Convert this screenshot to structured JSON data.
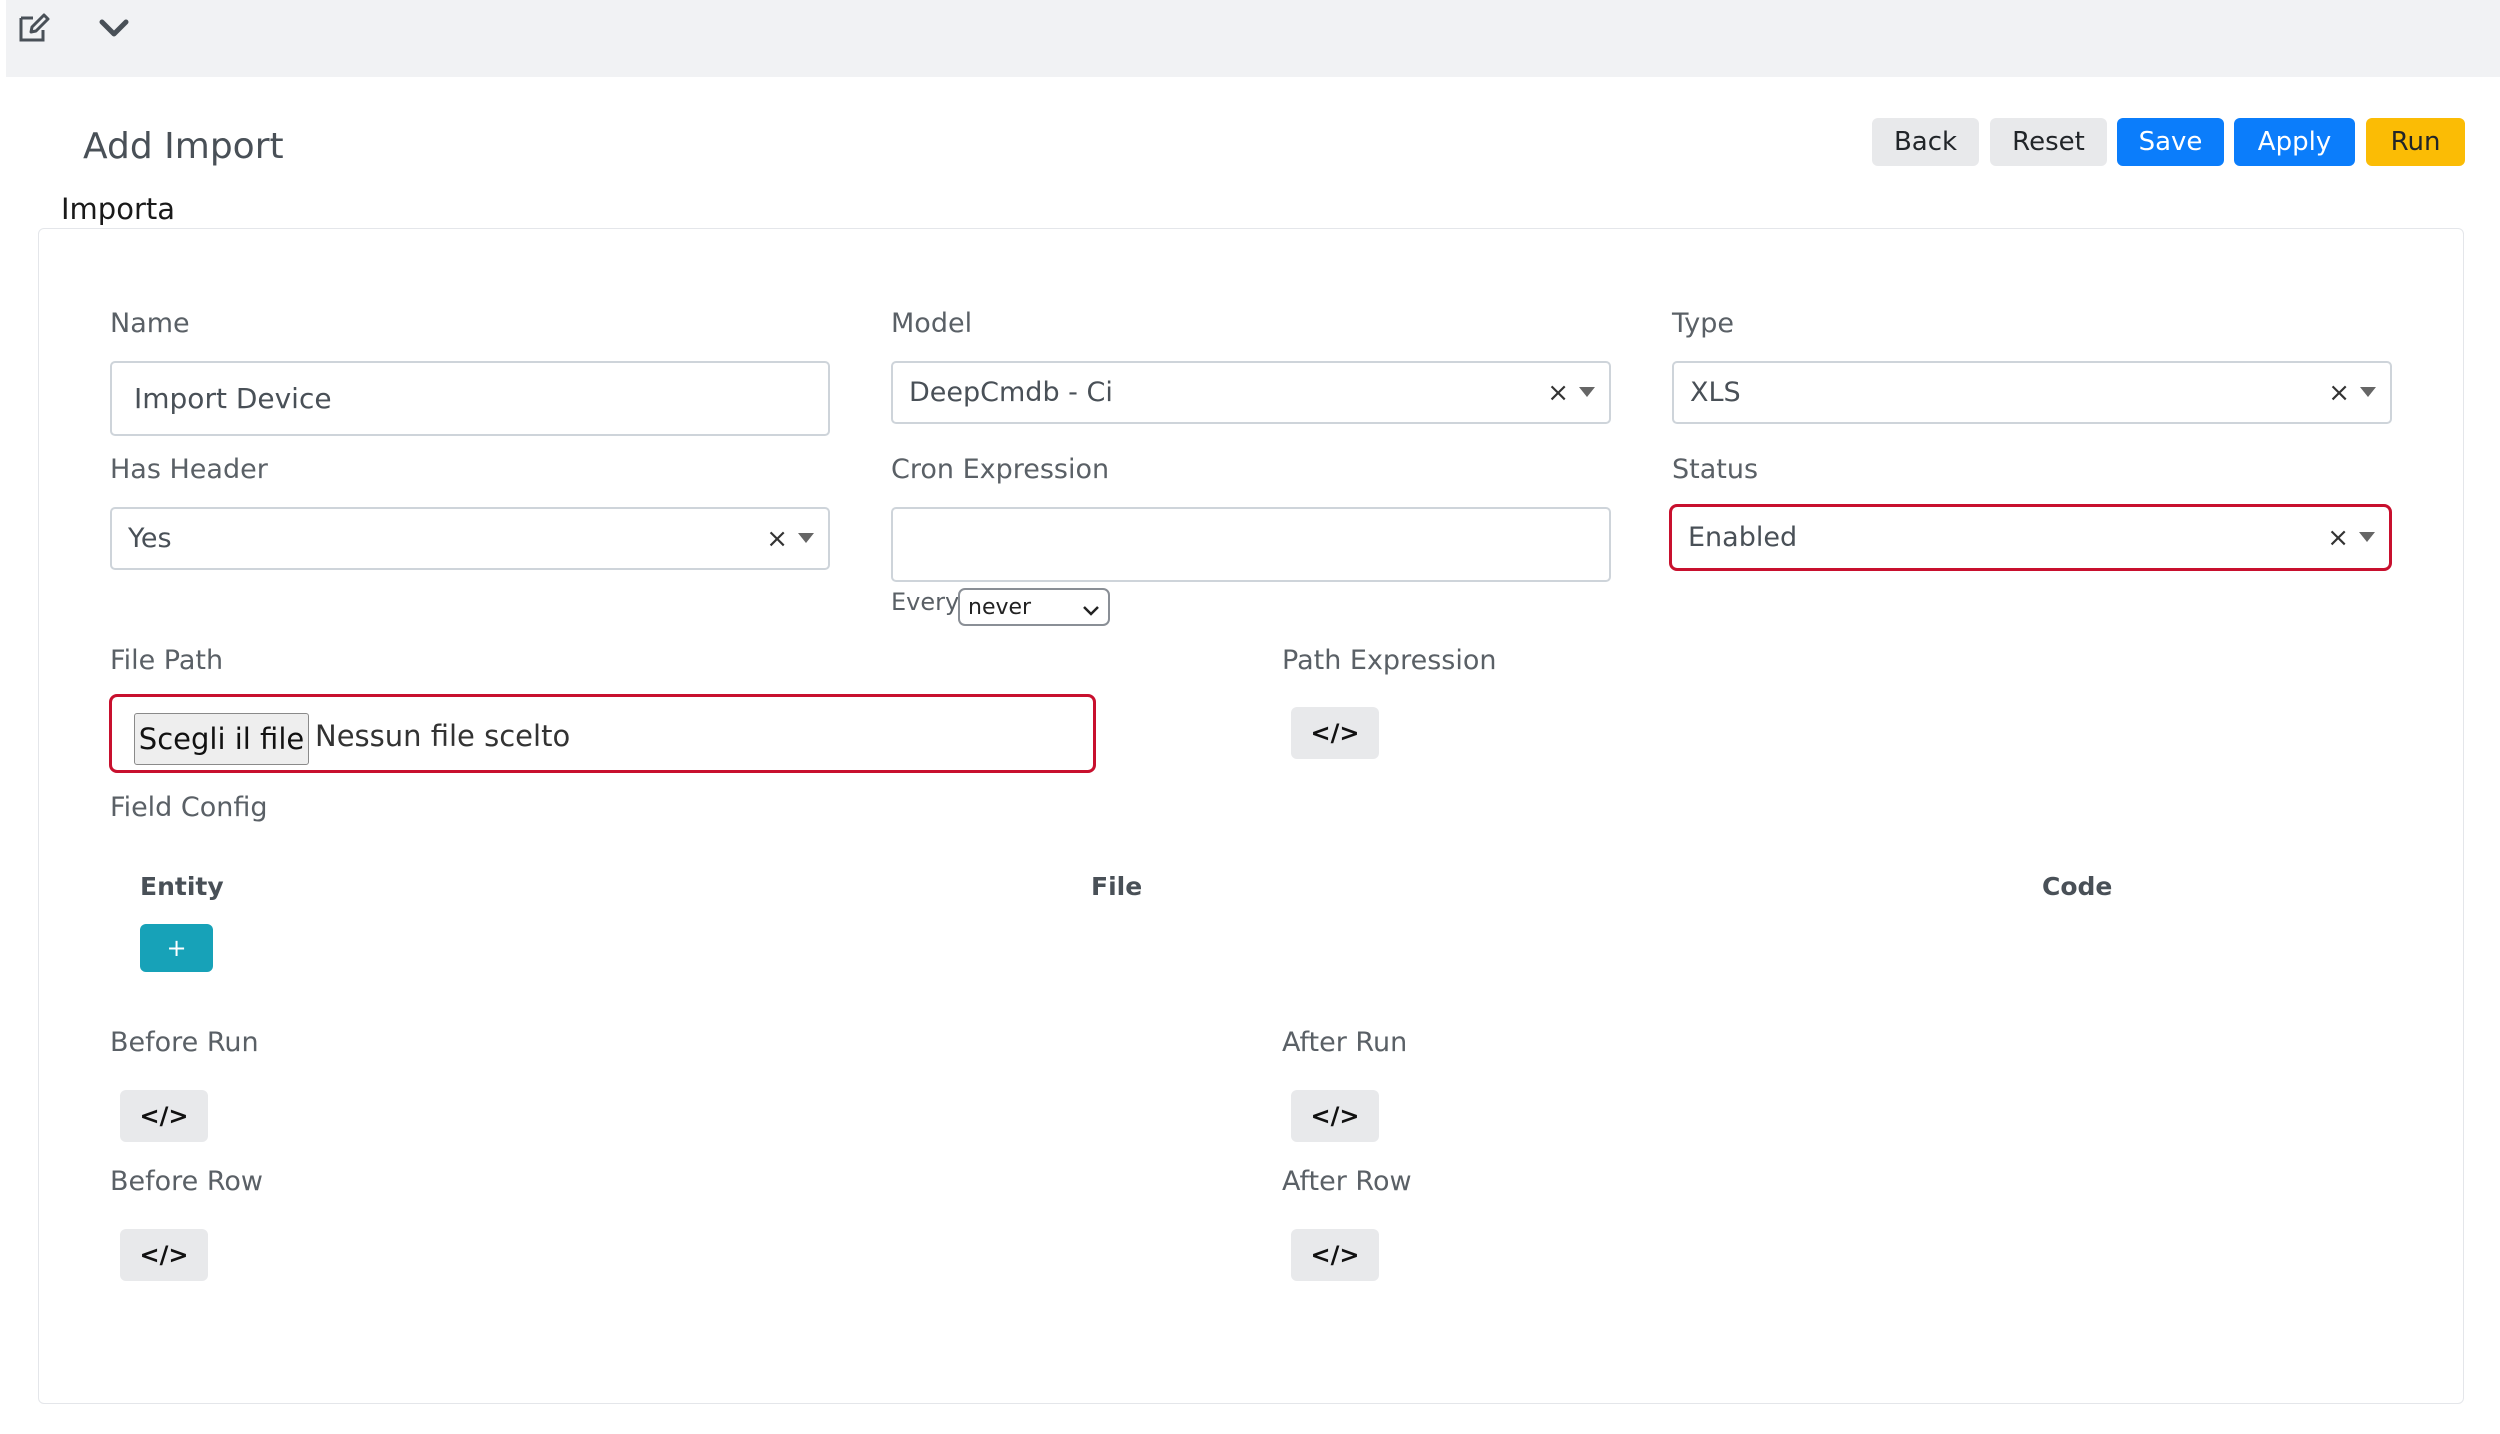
{
  "toolbar": {
    "edit_icon": "edit-icon",
    "chevron_icon": "chevron-down-icon"
  },
  "header": {
    "title": "Add Import",
    "subtitle": "Importa",
    "buttons": {
      "back": "Back",
      "reset": "Reset",
      "save": "Save",
      "apply": "Apply",
      "run": "Run"
    }
  },
  "form": {
    "name": {
      "label": "Name",
      "value": "Import Device"
    },
    "model": {
      "label": "Model",
      "value": "DeepCmdb - Ci",
      "clear": "×"
    },
    "type": {
      "label": "Type",
      "value": "XLS",
      "clear": "×"
    },
    "has_header": {
      "label": "Has Header",
      "value": "Yes",
      "clear": "×"
    },
    "cron": {
      "label": "Cron Expression",
      "value": "",
      "every_label": "Every",
      "every_value": "never"
    },
    "status": {
      "label": "Status",
      "value": "Enabled",
      "clear": "×"
    },
    "file_path": {
      "label": "File Path",
      "button": "Scegli il file",
      "status": "Nessun file scelto"
    },
    "path_expression": {
      "label": "Path Expression",
      "button": "</>"
    },
    "field_config": {
      "label": "Field Config",
      "columns": [
        "Entity",
        "File",
        "Code"
      ],
      "add_button": "+"
    },
    "before_run": {
      "label": "Before Run",
      "button": "</>"
    },
    "after_run": {
      "label": "After Run",
      "button": "</>"
    },
    "before_row": {
      "label": "Before Row",
      "button": "</>"
    },
    "after_row": {
      "label": "After Row",
      "button": "</>"
    }
  },
  "colors": {
    "primary": "#0b7dfb",
    "warning": "#fbbc05",
    "info": "#17a2b8",
    "highlight": "#c8102e"
  }
}
